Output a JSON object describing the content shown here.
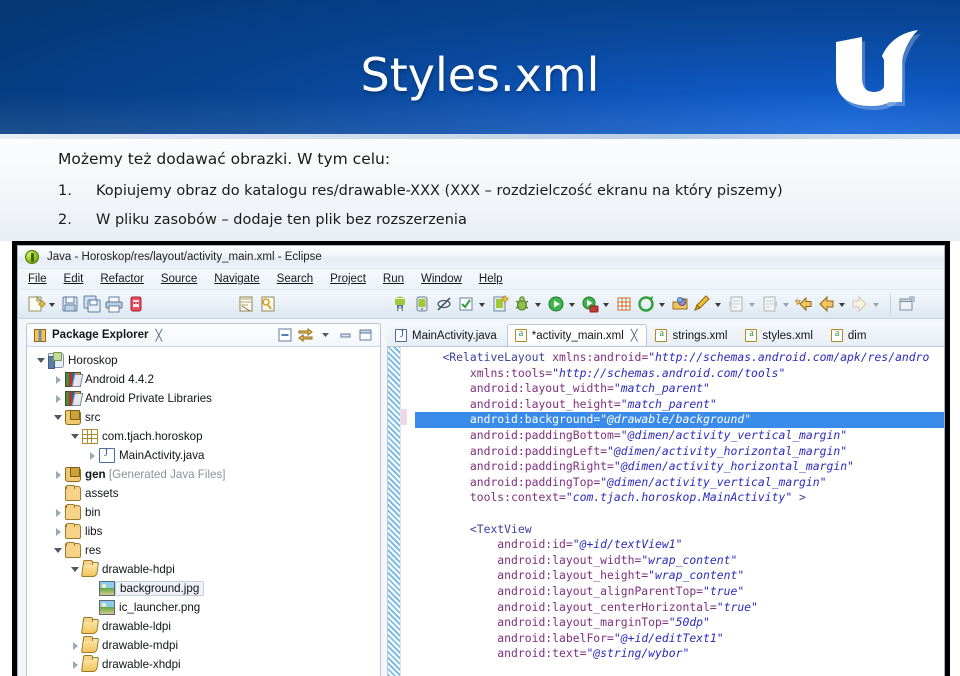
{
  "slide": {
    "title": "Styles.xml",
    "logo_alt": "ur-logo",
    "lead_text": "Możemy też dodawać obrazki. W tym celu:",
    "items": [
      {
        "num": "1.",
        "text": "Kopiujemy obraz do katalogu res/drawable-XXX (XXX – rozdzielczość ekranu na który piszemy)"
      },
      {
        "num": "2.",
        "text": "W pliku zasobów – dodaje ten plik bez rozszerzenia"
      }
    ],
    "header_color_dark": "#063b80",
    "header_color_light": "#1565d8"
  },
  "eclipse": {
    "window_title": "Java - Horoskop/res/layout/activity_main.xml - Eclipse",
    "menus": [
      "File",
      "Edit",
      "Refactor",
      "Source",
      "Navigate",
      "Search",
      "Project",
      "Run",
      "Window",
      "Help"
    ],
    "toolbar_icons": [
      "new-wizard-icon",
      "save-icon",
      "save-all-icon",
      "print-icon",
      "debug-android-icon",
      "build-icon",
      "key-icon",
      "android-sdk-manager-icon",
      "android-avd-manager-icon",
      "no-entry-icon",
      "checkmark-icon",
      "new-android-project-icon",
      "debug-icon",
      "run-icon",
      "run-coverage-icon",
      "new-package-icon",
      "new-class-icon",
      "open-type-icon",
      "search-icon",
      "next-annotation-icon",
      "previous-edit-icon",
      "back-icon",
      "forward-icon",
      "restore-icon"
    ],
    "package_explorer": {
      "tab_label": "Package Explorer",
      "tab_icon": "package-explorer-icon",
      "close_icon": "close-icon",
      "toolbar_icons": [
        "collapse-all-icon",
        "link-with-editor-icon",
        "view-menu-icon",
        "minimize-icon",
        "maximize-icon"
      ],
      "tree": [
        {
          "indent": 0,
          "twist": "open",
          "icon": "project-icon",
          "label": "Horoskop",
          "bold": false,
          "suffix": "",
          "selected": false
        },
        {
          "indent": 1,
          "twist": "closed",
          "icon": "library-icon",
          "label": "Android 4.4.2",
          "bold": false,
          "suffix": "",
          "selected": false
        },
        {
          "indent": 1,
          "twist": "closed",
          "icon": "library-icon",
          "label": "Android Private Libraries",
          "bold": false,
          "suffix": "",
          "selected": false
        },
        {
          "indent": 1,
          "twist": "open",
          "icon": "source-folder-icon",
          "label": "src",
          "bold": false,
          "suffix": "",
          "selected": false
        },
        {
          "indent": 2,
          "twist": "open",
          "icon": "package-icon",
          "label": "com.tjach.horoskop",
          "bold": false,
          "suffix": "",
          "selected": false
        },
        {
          "indent": 3,
          "twist": "closed",
          "icon": "java-file-icon",
          "label": "MainActivity.java",
          "bold": false,
          "suffix": "",
          "selected": false
        },
        {
          "indent": 1,
          "twist": "closed",
          "icon": "generated-folder-icon",
          "label": "gen",
          "bold": true,
          "suffix": "[Generated Java Files]",
          "selected": false
        },
        {
          "indent": 1,
          "twist": "none",
          "icon": "folder-icon",
          "label": "assets",
          "bold": false,
          "suffix": "",
          "selected": false
        },
        {
          "indent": 1,
          "twist": "closed",
          "icon": "folder-icon",
          "label": "bin",
          "bold": false,
          "suffix": "",
          "selected": false
        },
        {
          "indent": 1,
          "twist": "closed",
          "icon": "folder-icon",
          "label": "libs",
          "bold": false,
          "suffix": "",
          "selected": false
        },
        {
          "indent": 1,
          "twist": "open",
          "icon": "folder-icon",
          "label": "res",
          "bold": false,
          "suffix": "",
          "selected": false
        },
        {
          "indent": 2,
          "twist": "open",
          "icon": "open-folder-icon",
          "label": "drawable-hdpi",
          "bold": false,
          "suffix": "",
          "selected": false
        },
        {
          "indent": 3,
          "twist": "none",
          "icon": "image-file-icon",
          "label": "background.jpg",
          "bold": false,
          "suffix": "",
          "selected": true
        },
        {
          "indent": 3,
          "twist": "none",
          "icon": "image-file-icon",
          "label": "ic_launcher.png",
          "bold": false,
          "suffix": "",
          "selected": false
        },
        {
          "indent": 2,
          "twist": "none",
          "icon": "open-folder-icon",
          "label": "drawable-ldpi",
          "bold": false,
          "suffix": "",
          "selected": false
        },
        {
          "indent": 2,
          "twist": "closed",
          "icon": "open-folder-icon",
          "label": "drawable-mdpi",
          "bold": false,
          "suffix": "",
          "selected": false
        },
        {
          "indent": 2,
          "twist": "closed",
          "icon": "open-folder-icon",
          "label": "drawable-xhdpi",
          "bold": false,
          "suffix": "",
          "selected": false
        }
      ]
    },
    "editor": {
      "tabs": [
        {
          "label": "MainActivity.java",
          "icon": "java-file-icon",
          "active": false,
          "closable": false
        },
        {
          "label": "*activity_main.xml",
          "icon": "xml-file-icon",
          "active": true,
          "closable": true
        },
        {
          "label": "strings.xml",
          "icon": "xml-file-icon",
          "active": false,
          "closable": false
        },
        {
          "label": "styles.xml",
          "icon": "xml-file-icon",
          "active": false,
          "closable": false
        },
        {
          "label": "dim",
          "icon": "xml-file-icon",
          "active": false,
          "closable": false
        }
      ],
      "highlighted_line_index": 4,
      "lines": [
        [
          {
            "t": "pl",
            "s": "    "
          },
          {
            "t": "tag",
            "s": "<RelativeLayout"
          },
          {
            "t": "pl",
            "s": " "
          },
          {
            "t": "attr",
            "s": "xmlns:android="
          },
          {
            "t": "val",
            "s": "\"http://schemas.android.com/apk/res/andro"
          }
        ],
        [
          {
            "t": "pl",
            "s": "        "
          },
          {
            "t": "attr",
            "s": "xmlns:tools="
          },
          {
            "t": "val",
            "s": "\"http://schemas.android.com/tools\""
          }
        ],
        [
          {
            "t": "pl",
            "s": "        "
          },
          {
            "t": "attr",
            "s": "android:layout_width="
          },
          {
            "t": "val",
            "s": "\"match_parent\""
          }
        ],
        [
          {
            "t": "pl",
            "s": "        "
          },
          {
            "t": "attr",
            "s": "android:layout_height="
          },
          {
            "t": "val",
            "s": "\"match_parent\""
          }
        ],
        [
          {
            "t": "pl",
            "s": "        "
          },
          {
            "t": "attr",
            "s": "android:background="
          },
          {
            "t": "val",
            "s": "\"@drawable/background\""
          }
        ],
        [
          {
            "t": "pl",
            "s": "        "
          },
          {
            "t": "attr",
            "s": "android:paddingBottom="
          },
          {
            "t": "val",
            "s": "\"@dimen/activity_vertical_margin\""
          }
        ],
        [
          {
            "t": "pl",
            "s": "        "
          },
          {
            "t": "attr",
            "s": "android:paddingLeft="
          },
          {
            "t": "val",
            "s": "\"@dimen/activity_horizontal_margin\""
          }
        ],
        [
          {
            "t": "pl",
            "s": "        "
          },
          {
            "t": "attr",
            "s": "android:paddingRight="
          },
          {
            "t": "val",
            "s": "\"@dimen/activity_horizontal_margin\""
          }
        ],
        [
          {
            "t": "pl",
            "s": "        "
          },
          {
            "t": "attr",
            "s": "android:paddingTop="
          },
          {
            "t": "val",
            "s": "\"@dimen/activity_vertical_margin\""
          }
        ],
        [
          {
            "t": "pl",
            "s": "        "
          },
          {
            "t": "attr",
            "s": "tools:context="
          },
          {
            "t": "val",
            "s": "\"com.tjach.horoskop.MainActivity\""
          },
          {
            "t": "tag",
            "s": " >"
          }
        ],
        [
          {
            "t": "pl",
            "s": ""
          }
        ],
        [
          {
            "t": "pl",
            "s": "        "
          },
          {
            "t": "tag",
            "s": "<TextView"
          }
        ],
        [
          {
            "t": "pl",
            "s": "            "
          },
          {
            "t": "attr",
            "s": "android:id="
          },
          {
            "t": "val",
            "s": "\"@+id/textView1\""
          }
        ],
        [
          {
            "t": "pl",
            "s": "            "
          },
          {
            "t": "attr",
            "s": "android:layout_width="
          },
          {
            "t": "val",
            "s": "\"wrap_content\""
          }
        ],
        [
          {
            "t": "pl",
            "s": "            "
          },
          {
            "t": "attr",
            "s": "android:layout_height="
          },
          {
            "t": "val",
            "s": "\"wrap_content\""
          }
        ],
        [
          {
            "t": "pl",
            "s": "            "
          },
          {
            "t": "attr",
            "s": "android:layout_alignParentTop="
          },
          {
            "t": "val",
            "s": "\"true\""
          }
        ],
        [
          {
            "t": "pl",
            "s": "            "
          },
          {
            "t": "attr",
            "s": "android:layout_centerHorizontal="
          },
          {
            "t": "val",
            "s": "\"true\""
          }
        ],
        [
          {
            "t": "pl",
            "s": "            "
          },
          {
            "t": "attr",
            "s": "android:layout_marginTop="
          },
          {
            "t": "val",
            "s": "\"50dp\""
          }
        ],
        [
          {
            "t": "pl",
            "s": "            "
          },
          {
            "t": "attr",
            "s": "android:labelFor="
          },
          {
            "t": "val",
            "s": "\"@+id/editText1\""
          }
        ],
        [
          {
            "t": "pl",
            "s": "            "
          },
          {
            "t": "attr",
            "s": "android:text="
          },
          {
            "t": "val",
            "s": "\"@string/wybor\""
          }
        ]
      ]
    }
  }
}
